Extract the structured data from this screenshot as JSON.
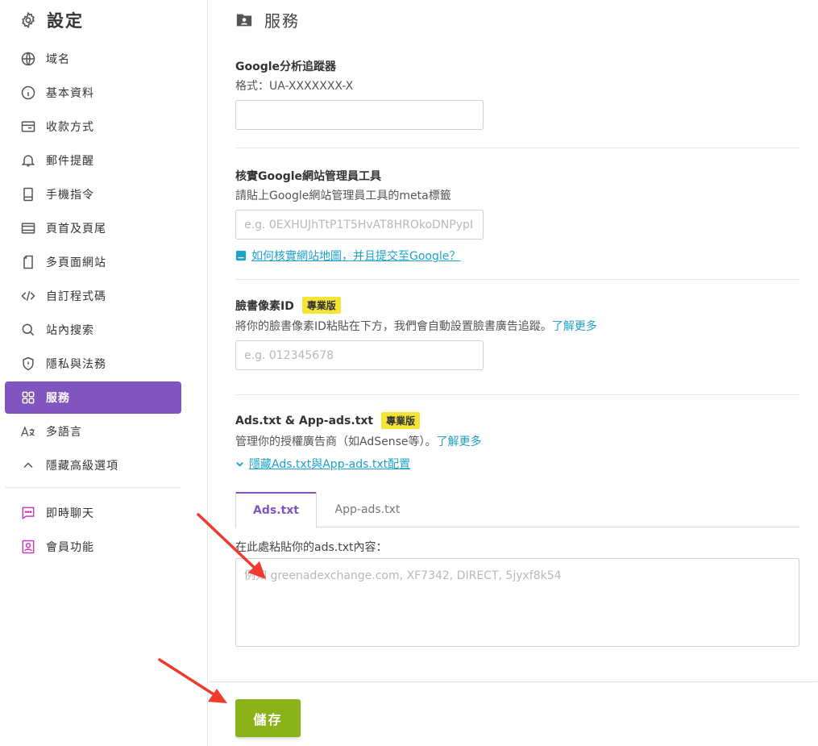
{
  "sidebar": {
    "title": "設定",
    "items": [
      {
        "label": "域名",
        "icon": "globe-icon"
      },
      {
        "label": "基本資料",
        "icon": "info-icon"
      },
      {
        "label": "收款方式",
        "icon": "payment-icon"
      },
      {
        "label": "郵件提醒",
        "icon": "bell-icon"
      },
      {
        "label": "手機指令",
        "icon": "mobile-icon"
      },
      {
        "label": "頁首及頁尾",
        "icon": "header-footer-icon"
      },
      {
        "label": "多頁面網站",
        "icon": "pages-icon"
      },
      {
        "label": "自訂程式碼",
        "icon": "code-icon"
      },
      {
        "label": "站內搜索",
        "icon": "search-icon"
      },
      {
        "label": "隱私與法務",
        "icon": "shield-icon"
      },
      {
        "label": "服務",
        "icon": "grid-icon",
        "active": true
      },
      {
        "label": "多語言",
        "icon": "language-icon"
      },
      {
        "label": "隱藏高級選項",
        "icon": "chevron-up-icon"
      }
    ],
    "extra_items": [
      {
        "label": "即時聊天",
        "icon": "chat-icon"
      },
      {
        "label": "會員功能",
        "icon": "member-icon"
      }
    ],
    "accent_color": "#8055bf",
    "extra_icon_color": "#c43ebd"
  },
  "main": {
    "title": "服務",
    "google_analytics": {
      "label": "Google分析追蹤器",
      "desc": "格式：UA-XXXXXXX-X",
      "value": ""
    },
    "google_webmaster": {
      "label": "核實Google網站管理員工具",
      "desc": "請貼上Google網站管理員工具的meta標籤",
      "placeholder": "e.g. 0EXHUJhTtP1T5HvAT8HROkoDNPypI",
      "help_link": "如何核實網站地圖，并且提交至Google？"
    },
    "facebook_pixel": {
      "label": "臉書像素ID",
      "badge": "專業版",
      "desc": "將你的臉書像素ID粘貼在下方，我們會自動設置臉書廣告追蹤。",
      "learn_more": "了解更多",
      "placeholder": "e.g. 012345678"
    },
    "ads_txt": {
      "label": "Ads.txt & App-ads.txt",
      "badge": "專業版",
      "desc": "管理你的授權廣告商（如AdSense等）。",
      "learn_more": "了解更多",
      "toggle_link": "隱藏Ads.txt與App-ads.txt配置",
      "tabs": [
        "Ads.txt",
        "App-ads.txt"
      ],
      "content_label": "在此處粘貼你的ads.txt內容：",
      "placeholder": "例如 greenadexchange.com, XF7342, DIRECT, 5jyxf8k54"
    },
    "save_label": "儲存"
  },
  "colors": {
    "link": "#1fa1c9",
    "badge": "#f2e535",
    "save": "#8cb21a",
    "arrow": "#f03a2e"
  }
}
